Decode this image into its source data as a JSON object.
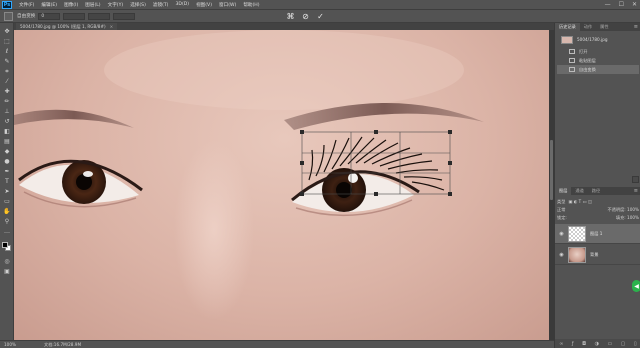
{
  "app": {
    "logo": "Ps",
    "menu": [
      "文件(F)",
      "编辑(E)",
      "图像(I)",
      "图层(L)",
      "文字(Y)",
      "选择(S)",
      "滤镜(T)",
      "3D(D)",
      "视图(V)",
      "窗口(W)",
      "帮助(H)"
    ],
    "window_controls": [
      "—",
      "☐",
      "✕"
    ]
  },
  "options": {
    "label1": "自由变换",
    "field1": "0",
    "label2": "",
    "cancel": "⊘",
    "commit": "✓",
    "warp": "⌘"
  },
  "document": {
    "tab_title": "5004/1780.jpg @ 100% (图层 1, RGB/8#)",
    "close": "×"
  },
  "statusbar": {
    "zoom": "100%",
    "info": "文档:16.7M/28.9M"
  },
  "history_panel": {
    "tabs": [
      "历史记录",
      "动作",
      "属性"
    ],
    "snapshot": "5004/1780.jpg",
    "items": [
      "打开",
      "粘贴图层",
      "自由变换"
    ]
  },
  "layers_panel": {
    "tabs": [
      "图层",
      "通道",
      "路径"
    ],
    "filter_label": "类型",
    "mode": "正常",
    "opacity_label": "不透明度: 100%",
    "lock_label": "锁定:",
    "fill_label": "填充: 100%",
    "layers": [
      {
        "name": "图层 1",
        "thumb": "transparent",
        "visible": true,
        "selected": true
      },
      {
        "name": "背景",
        "thumb": "face",
        "visible": true,
        "selected": false
      }
    ],
    "footer_icons": [
      "link-icon",
      "fx-icon",
      "mask-icon",
      "adjust-icon",
      "folder-icon",
      "new-layer-icon",
      "trash-icon"
    ]
  },
  "colors": {
    "ui_dark": "#535353",
    "panel_tab": "#424242",
    "selection": "#6a6a6a",
    "skin": "#dbb3a6",
    "green_button": "#2bb24c"
  }
}
